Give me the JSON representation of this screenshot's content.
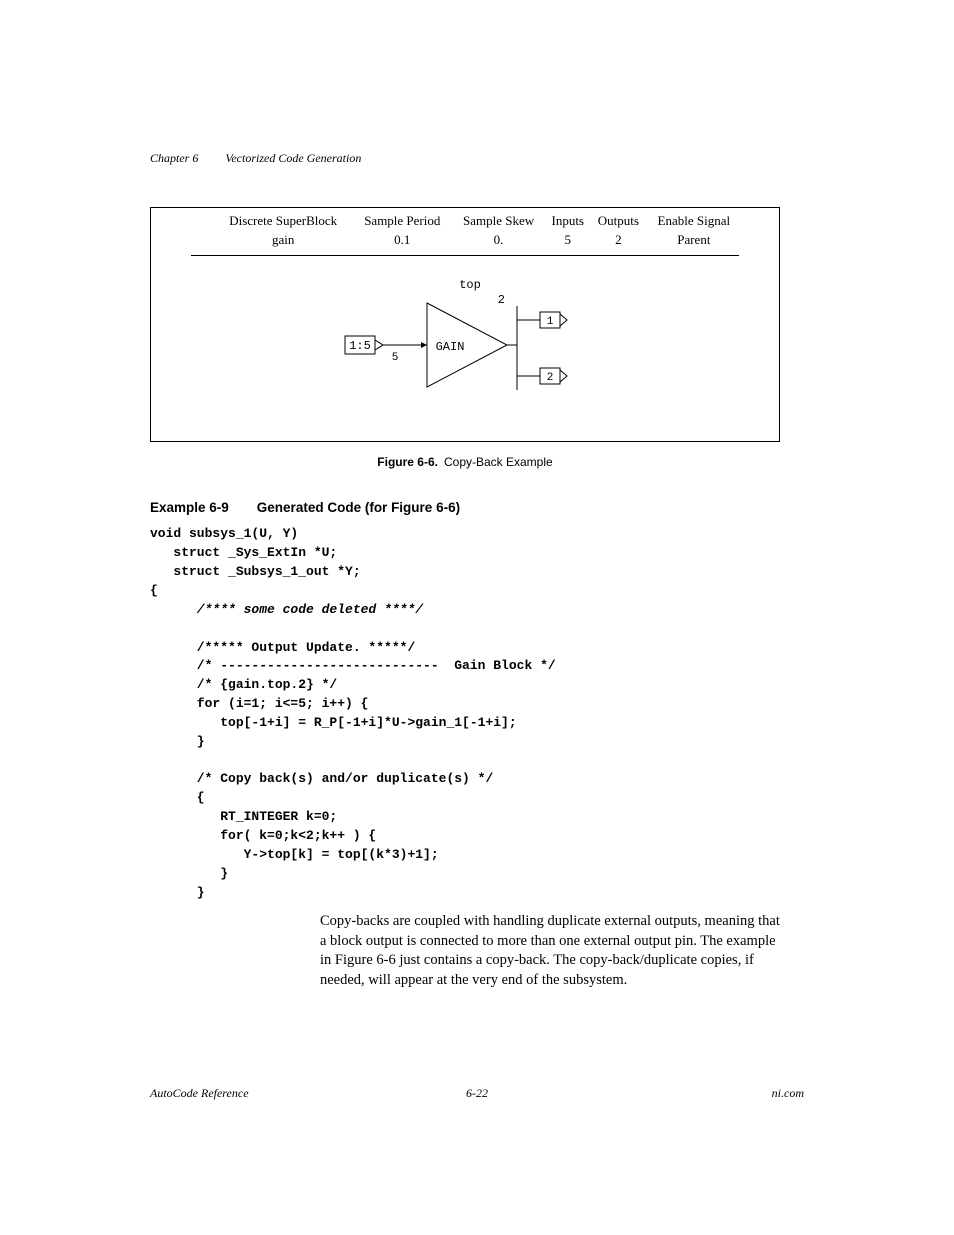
{
  "header": {
    "chapter": "Chapter 6",
    "title": "Vectorized Code Generation"
  },
  "figure": {
    "table": {
      "col1_label": "Discrete SuperBlock",
      "col1_value": "gain",
      "col2_label": "Sample Period",
      "col2_value": "0.1",
      "col3_label": "Sample Skew",
      "col3_value": "0.",
      "col4_label": "Inputs",
      "col4_value": "5",
      "col5_label": "Outputs",
      "col5_value": "2",
      "col6_label": "Enable Signal",
      "col6_value": "Parent"
    },
    "diagram": {
      "top_label": "top",
      "top_num": "2",
      "src_label": "1:5",
      "src_pin": "5",
      "block_label": "GAIN",
      "out1": "1",
      "out2": "2"
    },
    "caption_bold": "Figure 6-6.",
    "caption_rest": "Copy-Back Example"
  },
  "example": {
    "label": "Example 6-9",
    "title": "Generated Code (for Figure 6-6)"
  },
  "code": {
    "l01": "void subsys_1(U, Y)",
    "l02": "   struct _Sys_ExtIn *U;",
    "l03": "   struct _Subsys_1_out *Y;",
    "l04": "{",
    "l05": "      /**** some code deleted ****/",
    "l06": "",
    "l07": "      /***** Output Update. *****/",
    "l08": "      /* ----------------------------  Gain Block */",
    "l09": "      /* {gain.top.2} */",
    "l10": "      for (i=1; i<=5; i++) {",
    "l11": "         top[-1+i] = R_P[-1+i]*U->gain_1[-1+i];",
    "l12": "      }",
    "l13": "",
    "l14": "      /* Copy back(s) and/or duplicate(s) */",
    "l15": "      {",
    "l16": "         RT_INTEGER k=0;",
    "l17": "         for( k=0;k<2;k++ ) {",
    "l18": "            Y->top[k] = top[(k*3)+1];",
    "l19": "         }",
    "l20": "      }"
  },
  "paragraph": "Copy-backs are coupled with handling duplicate external outputs, meaning that a block output is connected to more than one external output pin. The example in Figure 6-6 just contains a copy-back. The copy-back/duplicate copies, if needed, will appear at the very end of the subsystem.",
  "footer": {
    "left": "AutoCode Reference",
    "center": "6-22",
    "right": "ni.com"
  }
}
